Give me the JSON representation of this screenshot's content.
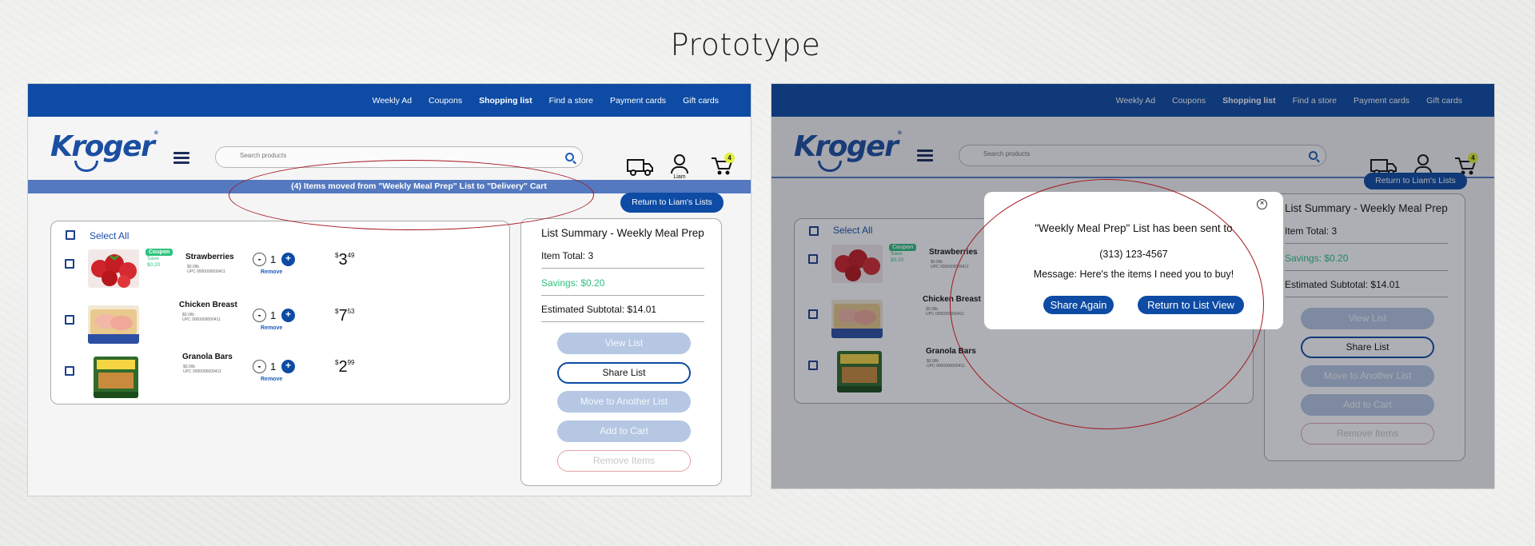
{
  "page_title": "Prototype",
  "nav": [
    "Weekly Ad",
    "Coupons",
    "Shopping list",
    "Find a store",
    "Payment cards",
    "Gift cards"
  ],
  "nav_active_index": 2,
  "brand": {
    "logo": "Kroger",
    "logo_mark": "®",
    "color": "#0d4ba4"
  },
  "search_placeholder": "Search products",
  "account_name": "Liam",
  "cart_count": "4",
  "banner_text": "(4) Items moved from \"Weekly Meal Prep\" List to \"Delivery\" Cart",
  "return_button": "Return to Liam's Lists",
  "select_all": "Select All",
  "items": [
    {
      "name": "Strawberries",
      "size": "$0.0/lb",
      "upc": "UPC 0000000000411",
      "qty": "1",
      "price_dollars": "3",
      "price_cents": "49",
      "coupon": "Coupon",
      "save": "Save",
      "save_amount": "$0.20",
      "remove": "Remove"
    },
    {
      "name": "Chicken Breast",
      "size": "$0.0/lb",
      "upc": "UPC 0000000000411",
      "qty": "1",
      "price_dollars": "7",
      "price_cents": "53",
      "remove": "Remove"
    },
    {
      "name": "Granola Bars",
      "size": "$0.0/lb",
      "upc": "UPC 0000000000411",
      "qty": "1",
      "price_dollars": "2",
      "price_cents": "99",
      "remove": "Remove"
    }
  ],
  "summary": {
    "title": "List Summary - Weekly Meal Prep",
    "item_total": "Item Total: 3",
    "savings": "Savings: $0.20",
    "subtotal": "Estimated Subtotal: $14.01",
    "buttons": [
      "View List",
      "Share List",
      "Move to Another List",
      "Add to Cart",
      "Remove Items"
    ]
  },
  "modal": {
    "heading": "\"Weekly Meal Prep\" List has been sent to",
    "phone": "(313) 123-4567",
    "message": "Message: Here's the items I need you to buy!",
    "share_again": "Share Again",
    "return_list": "Return to List View"
  },
  "colors": {
    "primary": "#0d4ba4",
    "banner": "#5479c0",
    "savings": "#2ec27e",
    "annotation": "#a3181f",
    "badge": "#e3f03a"
  }
}
